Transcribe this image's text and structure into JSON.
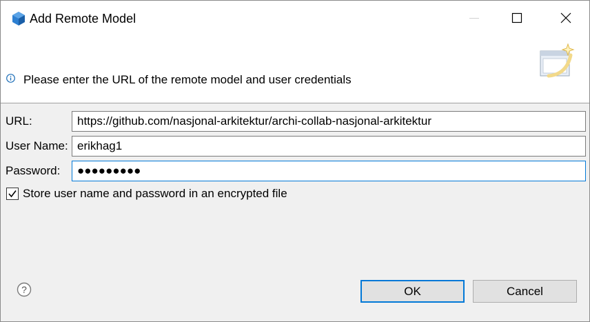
{
  "window": {
    "title": "Add Remote Model",
    "icon": "archi-hexagon-icon"
  },
  "banner": {
    "message": "Please enter the URL of the remote model and user credentials",
    "info_icon": "info-icon",
    "wizard_icon": "wizard-banner-icon"
  },
  "form": {
    "url_label": "URL:",
    "url_value": "https://github.com/nasjonal-arkitektur/archi-collab-nasjonal-arkitektur",
    "username_label": "User Name:",
    "username_value": "erikhag1",
    "password_label": "Password:",
    "password_value": "●●●●●●●●●",
    "store_checkbox_checked": true,
    "store_checkbox_label": "Store user name and password in an encrypted file"
  },
  "buttons": {
    "ok_label": "OK",
    "cancel_label": "Cancel",
    "help_icon": "help-icon"
  },
  "colors": {
    "focus_accent": "#0078d7",
    "dialog_bg": "#f0f0f0",
    "icon_blue": "#1e6fb8"
  }
}
